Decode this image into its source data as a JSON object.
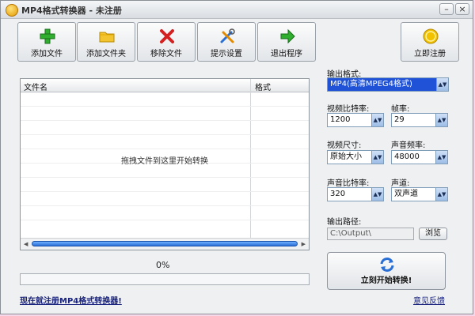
{
  "window": {
    "title": "MP4格式转换器 - 未注册"
  },
  "toolbar": [
    {
      "label": "添加文件",
      "icon": "plus-icon"
    },
    {
      "label": "添加文件夹",
      "icon": "folder-icon"
    },
    {
      "label": "移除文件",
      "icon": "remove-x-icon"
    },
    {
      "label": "提示设置",
      "icon": "tools-icon"
    },
    {
      "label": "退出程序",
      "icon": "exit-arrow-icon"
    }
  ],
  "register_button": {
    "label": "立即注册",
    "icon": "coin-icon"
  },
  "file_list": {
    "columns": [
      "文件名",
      "格式"
    ],
    "drop_hint": "拖拽文件到这里开始转换"
  },
  "progress": {
    "percent_text": "0%",
    "value": 0
  },
  "settings": {
    "output_format_label": "输出格式:",
    "output_format_value": "MP4(高清MPEG4格式)",
    "video_bitrate_label": "视频比特率:",
    "video_bitrate_value": "1200",
    "frame_rate_label": "帧率:",
    "frame_rate_value": "29",
    "video_size_label": "视频尺寸:",
    "video_size_value": "原始大小",
    "audio_sample_label": "声音频率:",
    "audio_sample_value": "48000",
    "audio_bitrate_label": "声音比特率:",
    "audio_bitrate_value": "320",
    "channels_label": "声道:",
    "channels_value": "双声道",
    "output_path_label": "输出路径:",
    "output_path_value": "C:\\Output\\",
    "browse_label": "浏览"
  },
  "convert_button": {
    "label": "立刻开始转换!"
  },
  "footer": {
    "register_link": "现在就注册MP4格式转换器!",
    "feedback_link": "意见反馈"
  },
  "colors": {
    "accent": "#1f52d6",
    "progress_thumb": "#2a6fd6",
    "link": "#1a237e"
  }
}
